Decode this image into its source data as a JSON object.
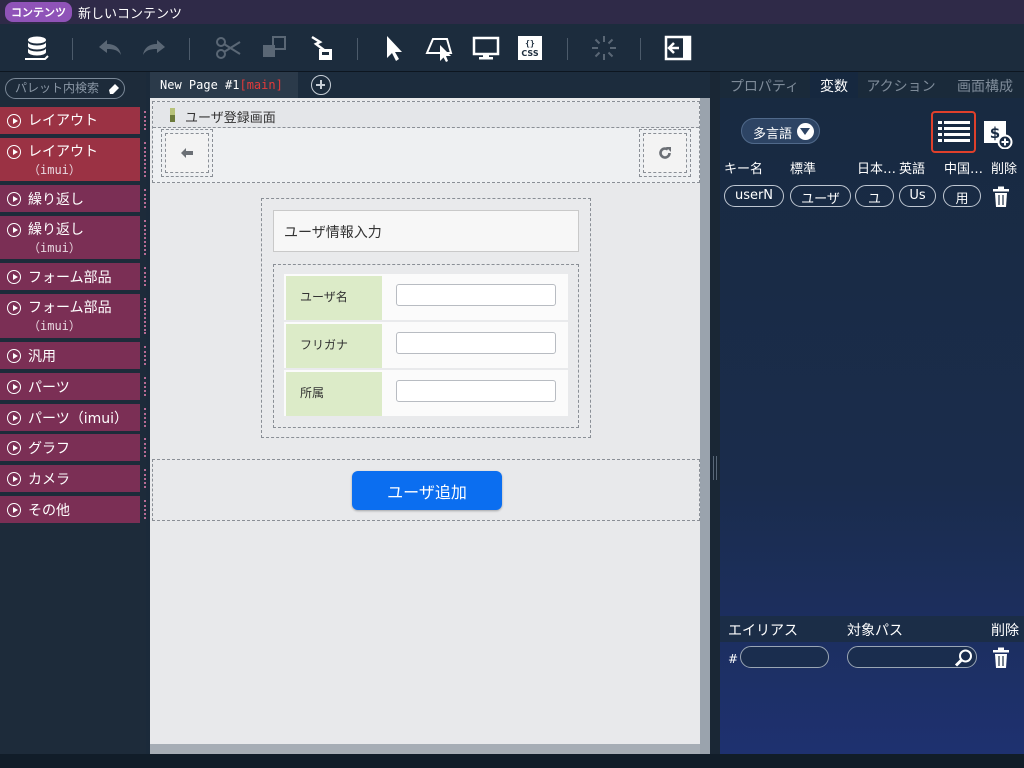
{
  "titlebar": {
    "badge": "コンテンツ",
    "title": "新しいコンテンツ"
  },
  "toolbar": {
    "icons": [
      "database-icon",
      "undo-icon",
      "redo-icon",
      "cut-icon",
      "copy-icon",
      "paste-icon",
      "select-cursor-icon",
      "element-select-icon",
      "preview-monitor-icon",
      "css-icon",
      "loading-icon",
      "exit-icon"
    ]
  },
  "palette": {
    "search_placeholder": "パレット内検索",
    "items": [
      {
        "label": "レイアウト",
        "sub": ""
      },
      {
        "label": "レイアウト",
        "sub": "（imui）"
      },
      {
        "label": "繰り返し",
        "sub": ""
      },
      {
        "label": "繰り返し",
        "sub": "（imui）"
      },
      {
        "label": "フォーム部品",
        "sub": ""
      },
      {
        "label": "フォーム部品",
        "sub": "（imui）"
      },
      {
        "label": "汎用",
        "sub": ""
      },
      {
        "label": "パーツ",
        "sub": ""
      },
      {
        "label": "パーツ（imui）",
        "sub": ""
      },
      {
        "label": "グラフ",
        "sub": ""
      },
      {
        "label": "カメラ",
        "sub": ""
      },
      {
        "label": "その他",
        "sub": ""
      }
    ]
  },
  "tabs": {
    "page_name": "New Page #1",
    "page_suffix": "[main]"
  },
  "canvas": {
    "header_title": "ユーザ登録画面",
    "form_title": "ユーザ情報入力",
    "fields": [
      {
        "label": "ユーザ名",
        "value": ""
      },
      {
        "label": "フリガナ",
        "value": ""
      },
      {
        "label": "所属",
        "value": ""
      }
    ],
    "submit_label": "ユーザ追加"
  },
  "right_panel": {
    "tabs": [
      "プロパティ",
      "変数",
      "アクション",
      "画面構成"
    ],
    "active_tab": "変数",
    "lang_button": "多言語",
    "var_headers": [
      "キー名",
      "標準",
      "日本…",
      "英語",
      "中国…",
      "削除"
    ],
    "var_row": [
      "userN",
      "ユーザ",
      "ユ",
      "Us",
      "用"
    ],
    "alias_headers": [
      "エイリアス",
      "対象パス",
      "削除"
    ],
    "alias_hash": "#"
  },
  "colors": {
    "palette_item": "#7b2f55",
    "palette_item_highlight": "#9b3244",
    "accent_button": "#0b6ef0",
    "highlight_border": "#e0402b",
    "label_cell": "#dcebc8"
  }
}
